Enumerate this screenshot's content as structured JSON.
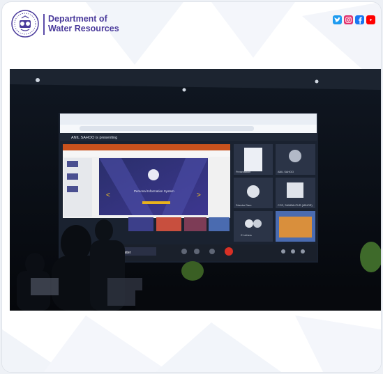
{
  "header": {
    "org_line1": "Department of",
    "org_line2": "Water Resources"
  },
  "social_icons": [
    {
      "name": "twitter-icon",
      "color": "#1d9bf0"
    },
    {
      "name": "instagram-icon",
      "color": "#e1306c"
    },
    {
      "name": "facebook-icon",
      "color": "#1877f2"
    },
    {
      "name": "youtube-icon",
      "color": "#ff0000"
    }
  ],
  "photo": {
    "meeting_title": "ANIL SAHOO is presenting",
    "slide_title": "Personal Information System",
    "tiles": [
      "Presentation",
      "ANIL SAHOO",
      "Director Dam",
      "CCE, SAMBALPUR (MINOR)",
      "21 others"
    ],
    "banner": "Day of World Water"
  },
  "colors": {
    "brand": "#4a3a9b",
    "photo_dark": "#0b0f17"
  }
}
